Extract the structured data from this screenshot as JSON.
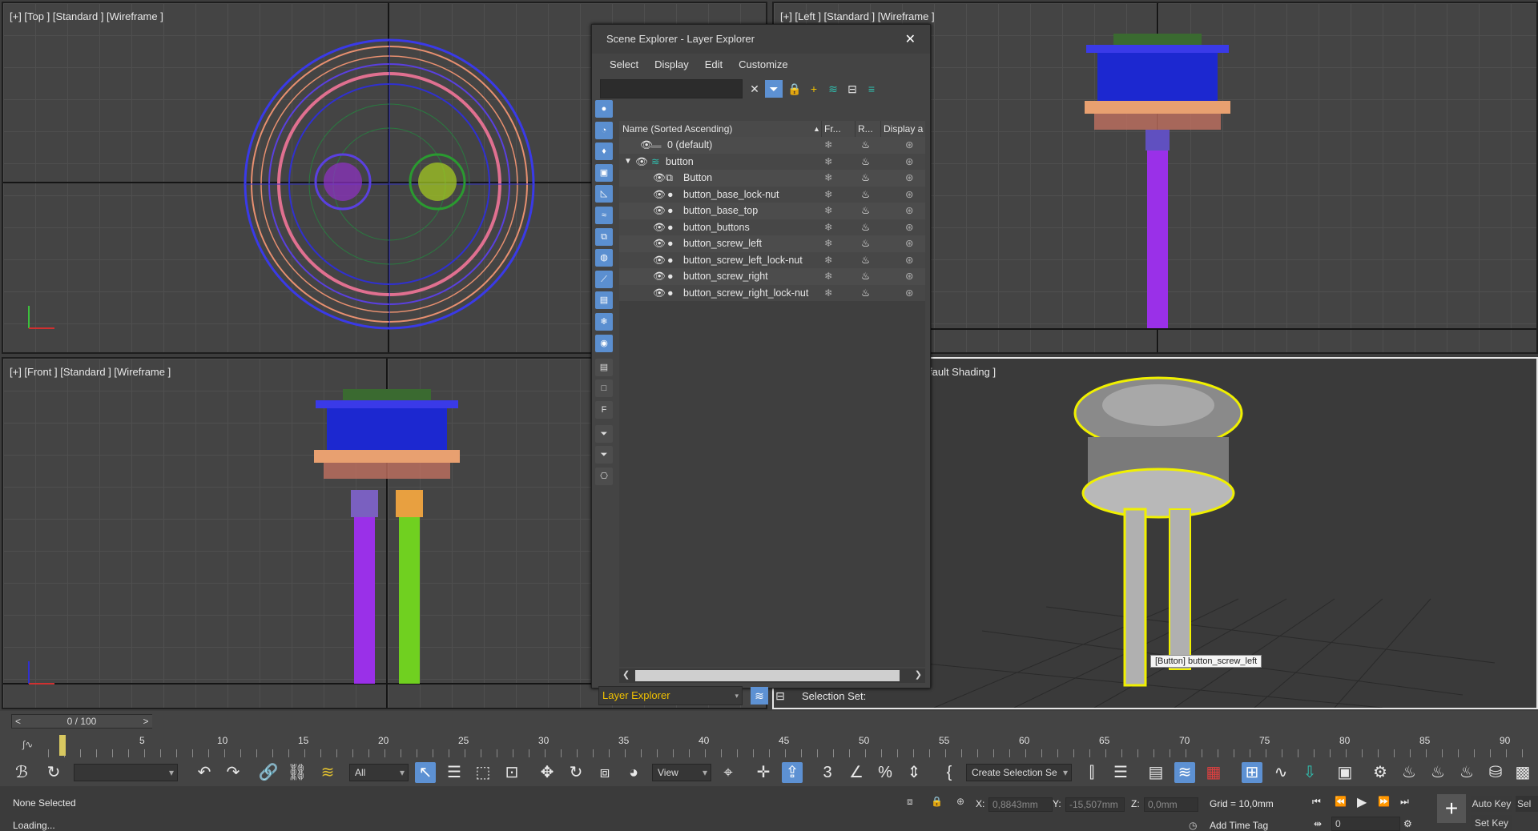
{
  "viewports": {
    "top": {
      "label": "[+] [Top ] [Standard ] [Wireframe ]"
    },
    "left": {
      "label": "[+] [Left ] [Standard ] [Wireframe ]"
    },
    "front": {
      "label": "[+] [Front ] [Standard ] [Wireframe ]"
    },
    "perspective": {
      "label": "fault Shading ]",
      "tooltip": "[Button] button_screw_left"
    }
  },
  "scene_explorer": {
    "title": "Scene Explorer - Layer Explorer",
    "close": "✕",
    "menu": [
      "Select",
      "Display",
      "Edit",
      "Customize"
    ],
    "columns": {
      "name": "Name (Sorted Ascending)",
      "sort": "▲",
      "frozen": "Fr...",
      "render": "R...",
      "display": "Display a"
    },
    "rows": [
      {
        "name": "0 (default)",
        "indent": 0
      },
      {
        "name": "button",
        "indent": 0
      },
      {
        "name": "Button",
        "indent": 1
      },
      {
        "name": "button_base_lock-nut",
        "indent": 1
      },
      {
        "name": "button_base_top",
        "indent": 1
      },
      {
        "name": "button_buttons",
        "indent": 1
      },
      {
        "name": "button_screw_left",
        "indent": 1
      },
      {
        "name": "button_screw_left_lock-nut",
        "indent": 1
      },
      {
        "name": "button_screw_right",
        "indent": 1
      },
      {
        "name": "button_screw_right_lock-nut",
        "indent": 1
      }
    ],
    "explorer_select": "Layer Explorer",
    "selection_set_label": "Selection Set:"
  },
  "timeline": {
    "frame_counter": "0 / 100",
    "prev": "<",
    "next": ">",
    "ticks": [
      "5",
      "10",
      "15",
      "20",
      "25",
      "30",
      "35",
      "40",
      "45",
      "50",
      "55",
      "60",
      "65",
      "70",
      "75",
      "80",
      "85",
      "90"
    ]
  },
  "toolbar": {
    "filter_all": "All",
    "ref_coord": "View",
    "selection_set": "Create Selection Se"
  },
  "status": {
    "selection": "None Selected",
    "prompt": "Loading...",
    "x_label": "X:",
    "x_value": "0,8843mm",
    "y_label": "Y:",
    "y_value": "-15,507mm",
    "z_label": "Z:",
    "z_value": "0,0mm",
    "grid": "Grid = 10,0mm",
    "add_time_tag": "Add Time Tag",
    "auto_key": "Auto Key",
    "set_key": "Set Key",
    "sel_short": "Sel",
    "frame_field": "0"
  }
}
